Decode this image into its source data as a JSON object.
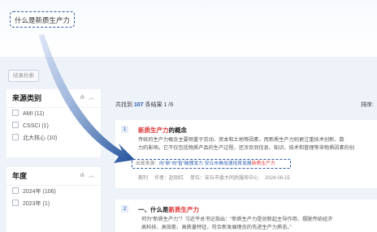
{
  "search": {
    "query": "什么是新质生产力"
  },
  "refine": {
    "label": "结果检索"
  },
  "facets": {
    "source": {
      "title": "来源类别",
      "options": [
        "AMI (11)",
        "CSSCI (1)",
        "北大核心 (10)"
      ]
    },
    "year": {
      "title": "年度",
      "options": [
        "2024年 (106)",
        "2023年 (1)"
      ]
    }
  },
  "results": {
    "prefix": "共找到",
    "count": "107",
    "suffix": "条结果",
    "page": "1 /6",
    "sort": "排序:"
  },
  "items": [
    {
      "index": "1",
      "title_hl": "新质生产力",
      "title_rest": "的概念",
      "snippet_line1": "传统的生产力概念主要侧重于劳动、资本和土地等因素。而新质生产力则更注重技术创新、数",
      "snippet_line2": "力的影响。它不仅包括物质产品的生产过程，还涉及到信息、知识、技术和管理等非物质因素的创",
      "from_label": "出现来源：",
      "from_pre": "向“新”向“智”破题发力 安丘市推加速培育发展",
      "from_hl": "新质生产力",
      "meta": {
        "journal": "期刊",
        "author": "作者：赵刚红",
        "org": "单位：安丘市委大同后服务中心",
        "date": "2024-06-15"
      }
    },
    {
      "index": "2",
      "title_pre": "一、什么是",
      "title_hl": "新质生产力",
      "snippet_line1": "何为“新质生产力”？习近平总书记指出：“新质生产力是创新起主导作用、摆脱传统经济",
      "snippet_line2": "高科技、高效能、高质量特征，符合新发展理念的先进生产力质态。”"
    }
  ],
  "colors": {
    "accent": "#2a5db0",
    "highlight": "#dd3333",
    "arrow": "#1f4f9a"
  },
  "icons": [
    "bar-chart-icon",
    "chevron-up-icon",
    "curved-arrow-icon"
  ]
}
